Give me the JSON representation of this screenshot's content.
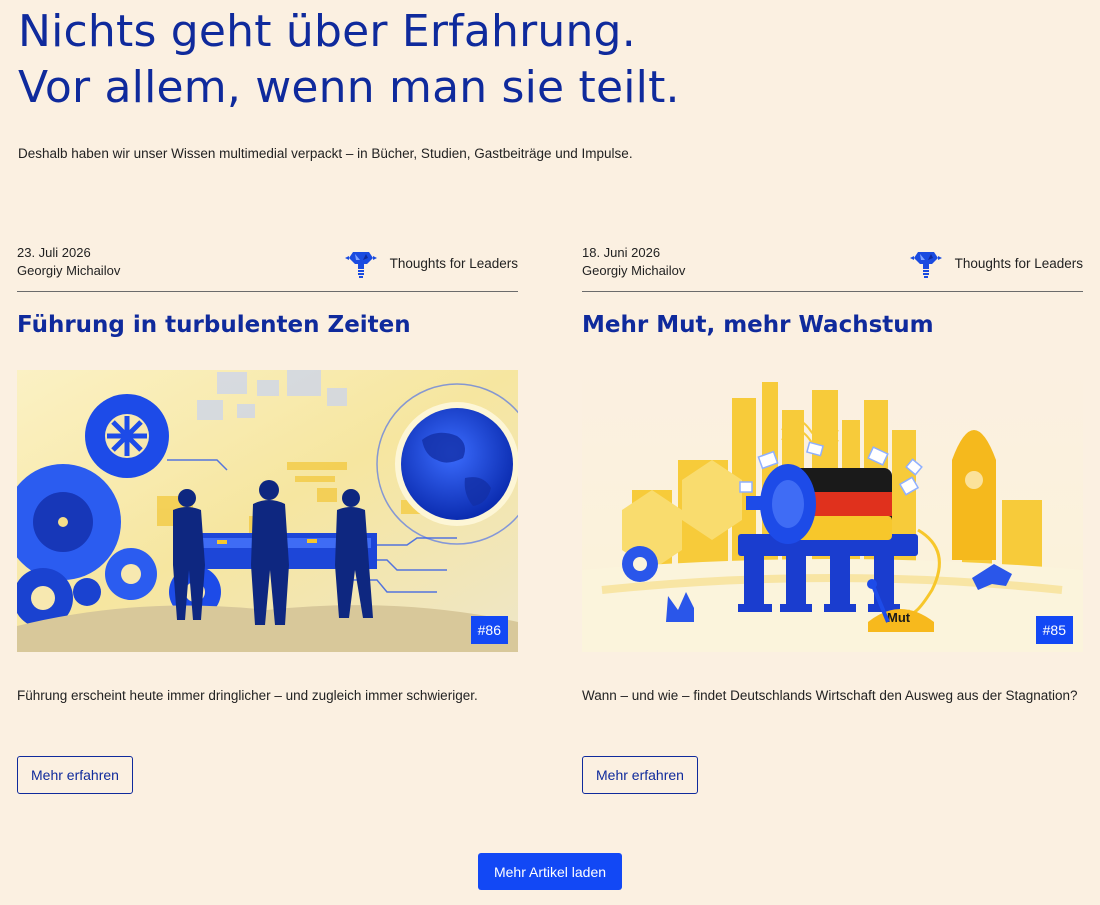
{
  "hero": {
    "title_line1": "Nichts geht über Erfahrung.",
    "title_line2": "Vor allem, wenn man sie teilt.",
    "subtitle": "Deshalb haben wir unser Wissen multimedial verpackt – in Bücher, Studien, Gastbeiträge und Impulse."
  },
  "articles": [
    {
      "date": "23. Juli 2026",
      "author": "Georgiy Michailov",
      "category": "Thoughts for Leaders",
      "category_icon": "lightbulb-lightning-icon",
      "title": "Führung in turbulenten Zeiten",
      "illustration": "leaders-gears-globe-illustration",
      "issue": "#86",
      "excerpt": "Führung erscheint heute immer dringlicher – und zugleich immer schwieriger.",
      "button": "Mehr erfahren"
    },
    {
      "date": "18. Juni 2026",
      "author": "Georgiy Michailov",
      "category": "Thoughts for Leaders",
      "category_icon": "lightbulb-lightning-icon",
      "title": "Mehr Mut, mehr Wachstum",
      "illustration": "economy-machine-illustration",
      "illustration_text": "Mut",
      "issue": "#85",
      "excerpt": "Wann – und wie – findet Deutschlands Wirtschaft den Ausweg aus der Stagnation?",
      "button": "Mehr erfahren"
    }
  ],
  "load_more": "Mehr Artikel laden",
  "colors": {
    "background": "#fbf0e1",
    "heading_blue": "#0f2a9c",
    "accent_blue": "#1248f5",
    "illustration_yellow": "#f7c72b"
  }
}
